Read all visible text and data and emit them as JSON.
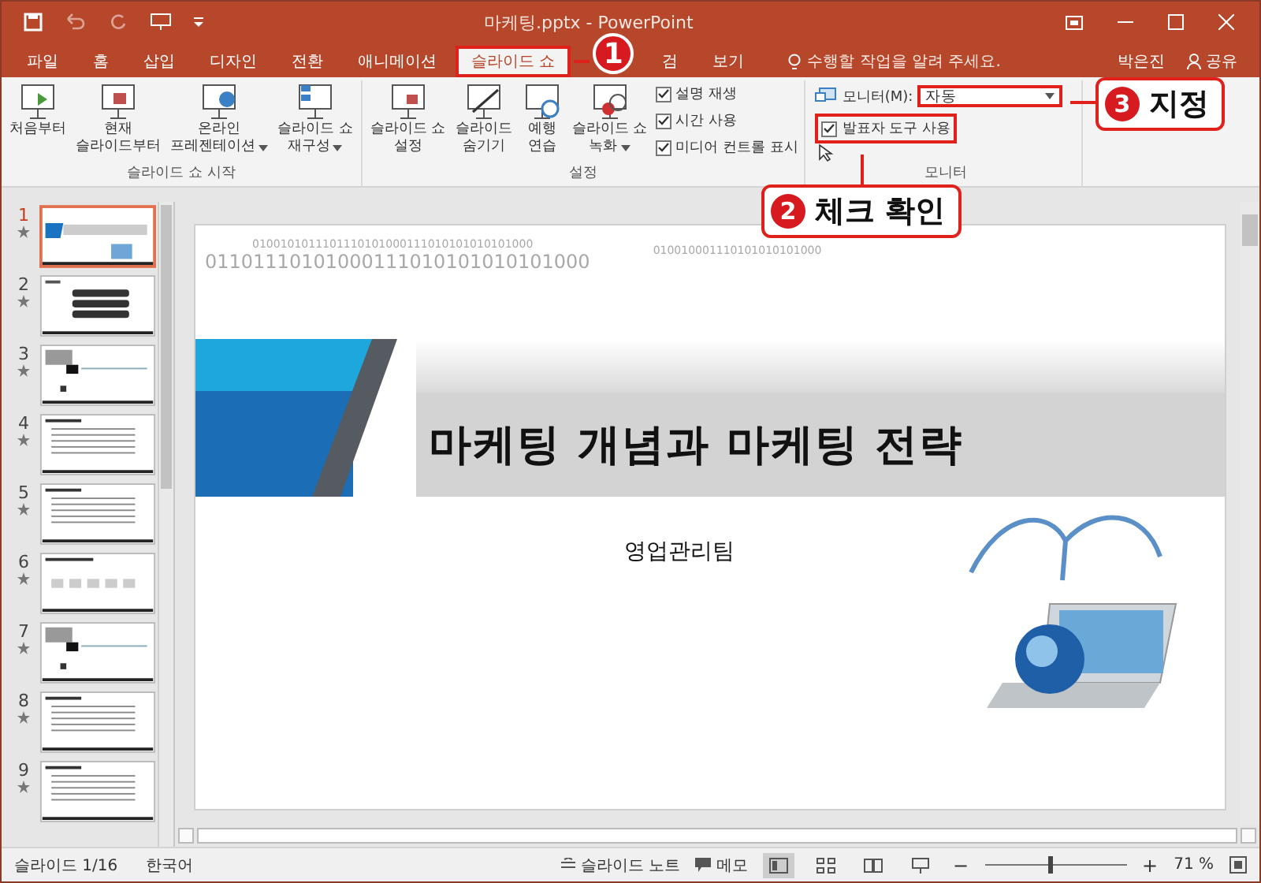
{
  "title_bar": {
    "document_title": "마케팅.pptx - PowerPoint"
  },
  "tabs": [
    {
      "label": "파일",
      "selected": false
    },
    {
      "label": "홈",
      "selected": false
    },
    {
      "label": "삽입",
      "selected": false
    },
    {
      "label": "디자인",
      "selected": false
    },
    {
      "label": "전환",
      "selected": false
    },
    {
      "label": "애니메이션",
      "selected": false
    },
    {
      "label": "슬라이드 쇼",
      "selected": true
    },
    {
      "label": "검",
      "selected": false
    },
    {
      "label": "보기",
      "selected": false
    }
  ],
  "tell_me": "수행할 작업을 알려 주세요.",
  "user": "박은진",
  "share": "공유",
  "ribbon": {
    "groups": [
      {
        "label": "슬라이드 쇼 시작",
        "buttons": [
          {
            "kind": "play",
            "lines": [
              "처음부터"
            ],
            "dropdown": false
          },
          {
            "kind": "current",
            "lines": [
              "현재",
              "슬라이드부터"
            ],
            "dropdown": false
          },
          {
            "kind": "online",
            "lines": [
              "온라인",
              "프레젠테이션"
            ],
            "dropdown": true
          },
          {
            "kind": "custom",
            "lines": [
              "슬라이드 쇼",
              "재구성"
            ],
            "dropdown": true
          }
        ]
      },
      {
        "label": "설정",
        "buttons": [
          {
            "kind": "setup",
            "lines": [
              "슬라이드 쇼",
              "설정"
            ],
            "dropdown": false
          },
          {
            "kind": "hide",
            "lines": [
              "슬라이드",
              "숨기기"
            ],
            "dropdown": false
          },
          {
            "kind": "rehearse",
            "lines": [
              "예행",
              "연습"
            ],
            "dropdown": false
          },
          {
            "kind": "record",
            "lines": [
              "슬라이드 쇼",
              "녹화"
            ],
            "dropdown": true
          }
        ],
        "checkboxes": [
          {
            "label": "설명 재생",
            "checked": true
          },
          {
            "label": "시간 사용",
            "checked": true
          },
          {
            "label": "미디어 컨트롤 표시",
            "checked": true
          }
        ]
      }
    ],
    "monitor": {
      "label": "모니터(M):",
      "value": "자동",
      "presenter_view": {
        "label": "발표자 도구 사용",
        "checked": true
      },
      "group_label": "모니터"
    }
  },
  "callouts": [
    {
      "number": "1"
    },
    {
      "number": "2",
      "text": "체크 확인"
    },
    {
      "number": "3",
      "text": "지정"
    }
  ],
  "thumbnails": [
    {
      "number": "1",
      "selected": true,
      "kind": "title"
    },
    {
      "number": "2",
      "selected": false,
      "kind": "agenda"
    },
    {
      "number": "3",
      "selected": false,
      "kind": "section"
    },
    {
      "number": "4",
      "selected": false,
      "kind": "text"
    },
    {
      "number": "5",
      "selected": false,
      "kind": "text"
    },
    {
      "number": "6",
      "selected": false,
      "kind": "process"
    },
    {
      "number": "7",
      "selected": false,
      "kind": "section"
    },
    {
      "number": "8",
      "selected": false,
      "kind": "text"
    },
    {
      "number": "9",
      "selected": false,
      "kind": "text"
    }
  ],
  "slide": {
    "binary_lines": [
      "0100101011101110101000111010101010101000",
      "01101110101000111010101010101000",
      "010010001110101010101000"
    ],
    "title": "마케팅 개념과 마케팅 전략",
    "subtitle": "영업관리팀"
  },
  "status_bar": {
    "slide_info": "슬라이드 1/16",
    "language": "한국어",
    "notes": "슬라이드 노트",
    "comments": "메모",
    "views": [
      {
        "kind": "normal",
        "selected": true
      },
      {
        "kind": "sorter",
        "selected": false
      },
      {
        "kind": "reading",
        "selected": false
      },
      {
        "kind": "show",
        "selected": false
      }
    ],
    "zoom_out": "−",
    "zoom": {
      "level": 0.45
    },
    "zoom_in": "+",
    "zoom_reading": "71 %"
  }
}
